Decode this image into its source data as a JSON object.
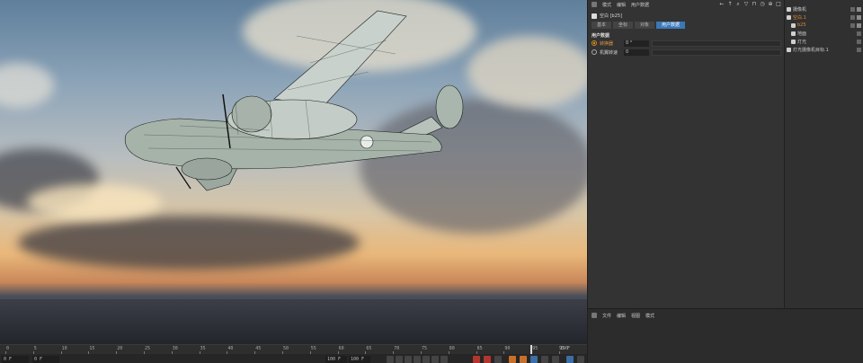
{
  "timeline": {
    "ticks": [
      "0",
      "5",
      "10",
      "15",
      "20",
      "25",
      "30",
      "35",
      "40",
      "45",
      "50",
      "55",
      "60",
      "65",
      "70",
      "75",
      "80",
      "85",
      "90",
      "95",
      "100"
    ],
    "playhead_label": "95",
    "current_frame": "0 F",
    "fields": [
      "0 F",
      "0 F",
      "100 F",
      "100 F"
    ],
    "end_frame": "95 F"
  },
  "attributes": {
    "menu": [
      "模式",
      "编辑",
      "用户数据"
    ],
    "object_title": "空白 [b25]",
    "tabs": [
      "基本",
      "坐标",
      "对象",
      "用户数据"
    ],
    "active_tab": "用户数据",
    "section": "用户数据",
    "params": [
      {
        "label": "转换器",
        "value": "0 °",
        "active": true
      },
      {
        "label": "机翼转速",
        "value": "0",
        "active": false
      }
    ]
  },
  "object_manager": {
    "objects": [
      {
        "name": "摄像机",
        "highlight": false
      },
      {
        "name": "空白.1",
        "highlight": true
      },
      {
        "name": "b25",
        "highlight": true
      },
      {
        "name": "地面",
        "highlight": false
      },
      {
        "name": "灯光",
        "highlight": false
      },
      {
        "name": "灯光摄像机目标.1",
        "highlight": false
      }
    ]
  },
  "bottom_panel": {
    "menu": [
      "文件",
      "编辑",
      "视图",
      "模式"
    ]
  }
}
